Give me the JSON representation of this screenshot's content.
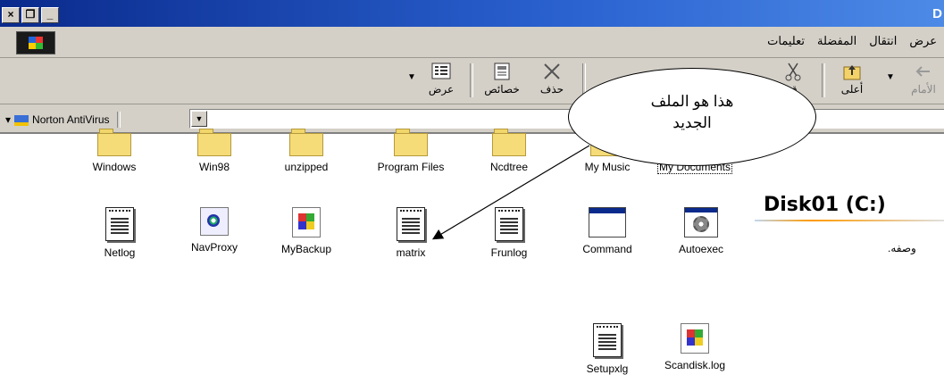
{
  "window": {
    "title": "D",
    "buttons": [
      "×",
      "❐",
      "_"
    ]
  },
  "menubar": {
    "items": [
      "عرض",
      "انتقال",
      "المفضلة",
      "تعليمات"
    ]
  },
  "toolbar": {
    "buttons": [
      {
        "label": "عرض",
        "icon": "view-icon"
      },
      {
        "label": "خصائص",
        "icon": "properties-icon"
      },
      {
        "label": "حذف",
        "icon": "delete-icon"
      },
      {
        "label": "ق",
        "icon": "cut-icon"
      },
      {
        "label": "أعلى",
        "icon": "up-icon"
      },
      {
        "label": "الأمام",
        "icon": "forward-icon"
      }
    ]
  },
  "addressbar": {
    "norton": "Norton AntiVirus",
    "value": ""
  },
  "callout": {
    "line1": "هذا هو الملف",
    "line2": "الجديد"
  },
  "files": {
    "row1": [
      "Windows",
      "Win98",
      "unzipped",
      "Program Files",
      "Ncdtree",
      "My Music",
      "My Documents"
    ],
    "row2": [
      "Netlog",
      "NavProxy",
      "MyBackup",
      "matrix",
      "Frunlog",
      "Command",
      "Autoexec"
    ],
    "row3": [
      "Setupxlg",
      "Scandisk.log"
    ]
  },
  "panel": {
    "disk_title": "Disk01 (C:)",
    "description": "وصفه."
  }
}
